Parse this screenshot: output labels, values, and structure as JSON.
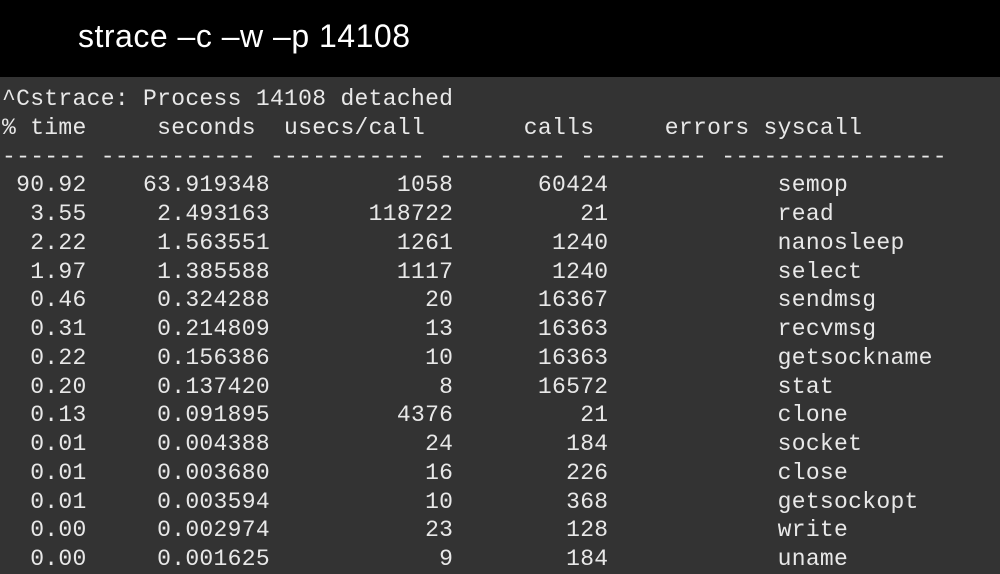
{
  "title": "strace –c –w –p 14108",
  "detached_line": "^Cstrace: Process 14108 detached",
  "headers": {
    "pct_time": "% time",
    "seconds": "seconds",
    "usecs_call": "usecs/call",
    "calls": "calls",
    "errors": "errors",
    "syscall": "syscall"
  },
  "divider": "------ ----------- ----------- --------- --------- ----------------",
  "rows": [
    {
      "pct_time": "90.92",
      "seconds": "63.919348",
      "usecs_call": "1058",
      "calls": "60424",
      "errors": "",
      "syscall": "semop"
    },
    {
      "pct_time": "3.55",
      "seconds": "2.493163",
      "usecs_call": "118722",
      "calls": "21",
      "errors": "",
      "syscall": "read"
    },
    {
      "pct_time": "2.22",
      "seconds": "1.563551",
      "usecs_call": "1261",
      "calls": "1240",
      "errors": "",
      "syscall": "nanosleep"
    },
    {
      "pct_time": "1.97",
      "seconds": "1.385588",
      "usecs_call": "1117",
      "calls": "1240",
      "errors": "",
      "syscall": "select"
    },
    {
      "pct_time": "0.46",
      "seconds": "0.324288",
      "usecs_call": "20",
      "calls": "16367",
      "errors": "",
      "syscall": "sendmsg"
    },
    {
      "pct_time": "0.31",
      "seconds": "0.214809",
      "usecs_call": "13",
      "calls": "16363",
      "errors": "",
      "syscall": "recvmsg"
    },
    {
      "pct_time": "0.22",
      "seconds": "0.156386",
      "usecs_call": "10",
      "calls": "16363",
      "errors": "",
      "syscall": "getsockname"
    },
    {
      "pct_time": "0.20",
      "seconds": "0.137420",
      "usecs_call": "8",
      "calls": "16572",
      "errors": "",
      "syscall": "stat"
    },
    {
      "pct_time": "0.13",
      "seconds": "0.091895",
      "usecs_call": "4376",
      "calls": "21",
      "errors": "",
      "syscall": "clone"
    },
    {
      "pct_time": "0.01",
      "seconds": "0.004388",
      "usecs_call": "24",
      "calls": "184",
      "errors": "",
      "syscall": "socket"
    },
    {
      "pct_time": "0.01",
      "seconds": "0.003680",
      "usecs_call": "16",
      "calls": "226",
      "errors": "",
      "syscall": "close"
    },
    {
      "pct_time": "0.01",
      "seconds": "0.003594",
      "usecs_call": "10",
      "calls": "368",
      "errors": "",
      "syscall": "getsockopt"
    },
    {
      "pct_time": "0.00",
      "seconds": "0.002974",
      "usecs_call": "23",
      "calls": "128",
      "errors": "",
      "syscall": "write"
    },
    {
      "pct_time": "0.00",
      "seconds": "0.001625",
      "usecs_call": "9",
      "calls": "184",
      "errors": "",
      "syscall": "uname"
    }
  ]
}
